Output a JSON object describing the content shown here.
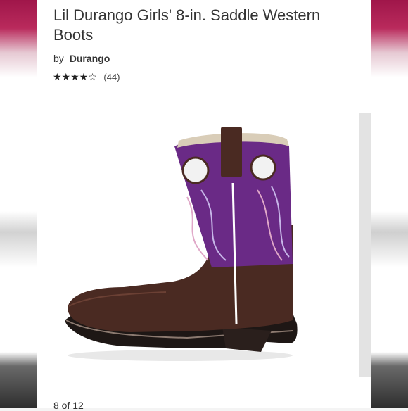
{
  "product": {
    "title": "Lil Durango Girls' 8-in. Saddle Western Boots",
    "by_label": "by",
    "brand": "Durango",
    "stars": "★★★★☆",
    "rating_value": 4,
    "review_count": "(44)"
  },
  "gallery": {
    "pager": "8 of 12",
    "image_icon": "boot-image"
  },
  "colors": {
    "shaft_purple": "#6a2a86",
    "leather_brown": "#4a2a22",
    "accent_pink": "#b92a5c"
  }
}
